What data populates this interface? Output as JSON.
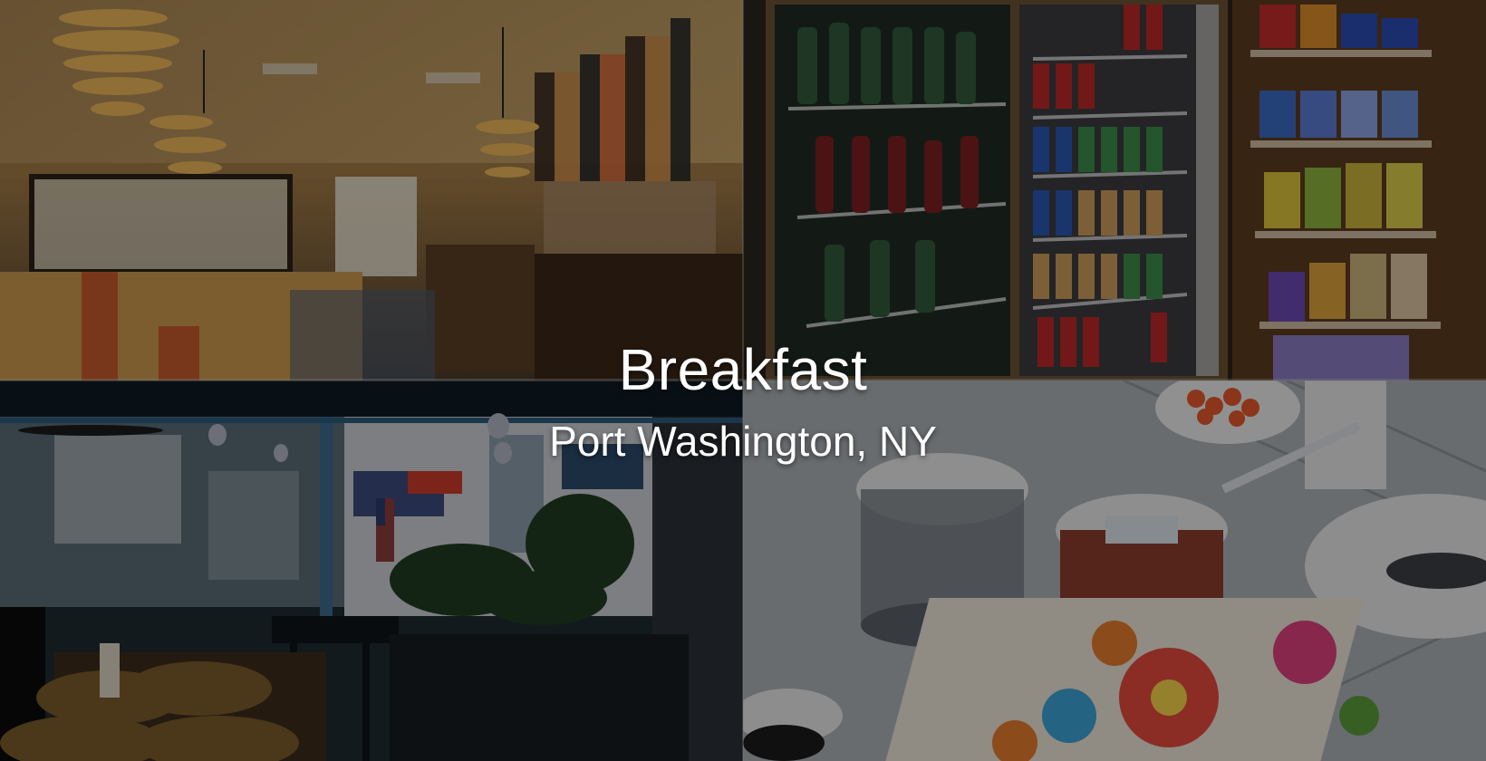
{
  "hero": {
    "title": "Breakfast",
    "subtitle": "Port Washington, NY"
  },
  "collage": {
    "tiles": [
      {
        "name": "restaurant-interior-photo"
      },
      {
        "name": "drink-cooler-and-chip-rack-photo"
      },
      {
        "name": "storefront-counter-photo"
      },
      {
        "name": "breakfast-table-photo"
      }
    ]
  },
  "colors": {
    "text": "#ffffff",
    "overlay": "rgba(0,0,0,0.38)"
  }
}
